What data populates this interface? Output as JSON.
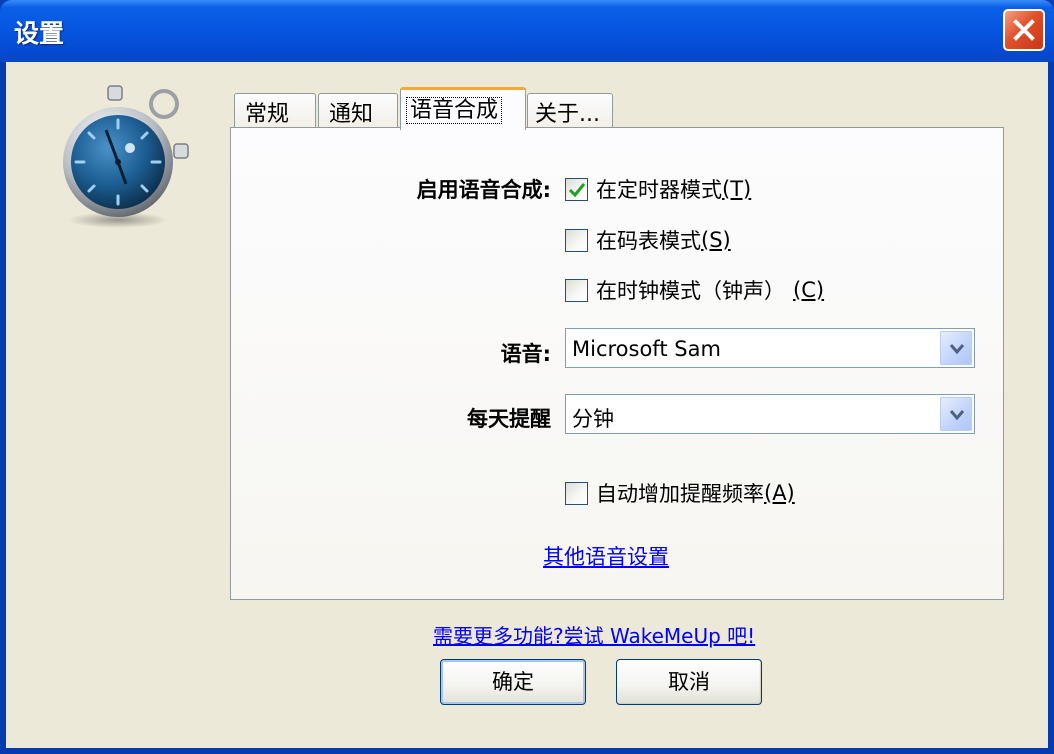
{
  "window": {
    "title": "设置"
  },
  "tabs": [
    {
      "label": "常规"
    },
    {
      "label": "通知"
    },
    {
      "label": "语音合成",
      "active": true
    },
    {
      "label": "关于..."
    }
  ],
  "speech": {
    "enable_label": "启用语音合成:",
    "timer_mode": {
      "label": "在定时器模式",
      "hotkey": "(T)",
      "checked": true
    },
    "stopwatch_mode": {
      "label": "在码表模式",
      "hotkey": "(S)",
      "checked": false
    },
    "clock_mode": {
      "label": "在时钟模式（钟声）",
      "hotkey": "(C)",
      "checked": false
    },
    "voice_label": "语音:",
    "voice_value": "Microsoft Sam",
    "daily_label": "每天提醒",
    "daily_value": "分钟",
    "auto_increase": {
      "label": "自动增加提醒频率",
      "hotkey": "(A)",
      "checked": false
    },
    "other_settings_link": "其他语音设置"
  },
  "promo_link": "需要更多功能?尝试 WakeMeUp 吧!",
  "buttons": {
    "ok": "确定",
    "cancel": "取消"
  },
  "colors": {
    "titlebar": "#0655e0",
    "client_bg": "#ece9d8",
    "link": "#0000ff",
    "tab_active_accent": "#f2a83a"
  },
  "icons": [
    "stopwatch-icon",
    "close-icon",
    "checkmark-icon",
    "dropdown-arrow-icon"
  ]
}
